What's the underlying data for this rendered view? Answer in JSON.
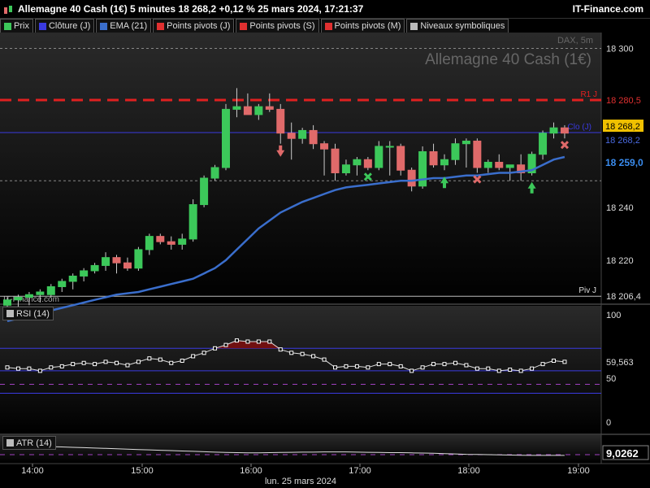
{
  "header": {
    "title": "Allemagne 40 Cash (1€) 5 minutes 18 268,2 +0,12 % 25 mars 2024, 17:21:37",
    "brand": "IT-Finance.com"
  },
  "legend": [
    {
      "label": "Prix",
      "color": "#3cc85a"
    },
    {
      "label": "Clôture (J)",
      "color": "#3a3ae0"
    },
    {
      "label": "EMA (21)",
      "color": "#3a6ecc"
    },
    {
      "label": "Points pivots (J)",
      "color": "#e03030"
    },
    {
      "label": "Points pivots (S)",
      "color": "#e03030"
    },
    {
      "label": "Points pivots (M)",
      "color": "#e03030"
    },
    {
      "label": "Niveaux symboliques",
      "color": "#bbbbbb"
    }
  ],
  "watermark": {
    "name": "Allemagne 40 Cash (1€)",
    "sub": "DAX, 5m",
    "credit": "IT-Finance.com"
  },
  "price_axis_labels": [
    {
      "text": "18 300",
      "value": 18300,
      "style": "tick"
    },
    {
      "text": "18 240",
      "value": 18240,
      "style": "tick"
    },
    {
      "text": "18 220",
      "value": 18220,
      "style": "tick"
    },
    {
      "text": "18 280,5",
      "value": 18280.5,
      "style": "r1"
    },
    {
      "text": "18 268,2",
      "value": 18268.2,
      "style": "last"
    },
    {
      "text": "18 268,2",
      "value": 18268.2,
      "style": "close"
    },
    {
      "text": "18 259,0",
      "value": 18259.0,
      "style": "ema"
    },
    {
      "text": "18 206,4",
      "value": 18206.4,
      "style": "piv"
    }
  ],
  "line_labels": {
    "r1": "R1 J",
    "clo": "Clo (J)",
    "piv": "Piv J"
  },
  "levels": {
    "r1": 18280.5,
    "clo": 18268.2,
    "piv": 18206.4,
    "symbolic": [
      18300,
      18250
    ]
  },
  "rsi": {
    "tag": "RSI (14)",
    "axis": [
      "100",
      "50",
      "0"
    ],
    "value_label": "59,563",
    "bands": [
      70,
      30
    ]
  },
  "atr": {
    "tag": "ATR (14)",
    "value_label": "9,0262"
  },
  "time_axis": {
    "labels": [
      "14:00",
      "15:00",
      "16:00",
      "17:00",
      "18:00",
      "19:00"
    ],
    "date": "lun. 25 mars 2024"
  },
  "colors": {
    "up": "#3cc85a",
    "down": "#e06a6a",
    "ema": "#3a6ecc",
    "r1": "#e02020",
    "close_line": "#3a3ae0",
    "rsi_line": "#dddddd"
  },
  "chart_data": {
    "type": "candlestick",
    "interval": "5m",
    "start_time": "13:50",
    "candles": [
      [
        18203,
        18206,
        18201,
        18205
      ],
      [
        18205,
        18207,
        18202,
        18206
      ],
      [
        18206,
        18208,
        18203,
        18207
      ],
      [
        18207,
        18209,
        18204,
        18208
      ],
      [
        18207,
        18211,
        18206,
        18210
      ],
      [
        18210,
        18213,
        18208,
        18212
      ],
      [
        18212,
        18215,
        18209,
        18214
      ],
      [
        18214,
        18217,
        18212,
        18216
      ],
      [
        18216,
        18219,
        18215,
        18218
      ],
      [
        18218,
        18223,
        18216,
        18221
      ],
      [
        18221,
        18222,
        18215,
        18219
      ],
      [
        18219,
        18221,
        18216,
        18217
      ],
      [
        18217,
        18225,
        18216,
        18224
      ],
      [
        18224,
        18230,
        18222,
        18229
      ],
      [
        18229,
        18230,
        18226,
        18227
      ],
      [
        18227,
        18229,
        18224,
        18226
      ],
      [
        18226,
        18230,
        18224,
        18228
      ],
      [
        18228,
        18243,
        18227,
        18241
      ],
      [
        18241,
        18252,
        18240,
        18251
      ],
      [
        18251,
        18256,
        18250,
        18255
      ],
      [
        18255,
        18279,
        18254,
        18277
      ],
      [
        18277,
        18285,
        18274,
        18278
      ],
      [
        18278,
        18283,
        18275,
        18275
      ],
      [
        18275,
        18279,
        18273,
        18278
      ],
      [
        18278,
        18283,
        18276,
        18277
      ],
      [
        18277,
        18279,
        18264,
        18268
      ],
      [
        18268,
        18272,
        18258,
        18266
      ],
      [
        18266,
        18270,
        18264,
        18269
      ],
      [
        18269,
        18271,
        18262,
        18264
      ],
      [
        18264,
        18265,
        18252,
        18262
      ],
      [
        18262,
        18264,
        18250,
        18253
      ],
      [
        18253,
        18258,
        18252,
        18256
      ],
      [
        18256,
        18259,
        18252,
        18258
      ],
      [
        18258,
        18259,
        18254,
        18255
      ],
      [
        18255,
        18265,
        18254,
        18263
      ],
      [
        18263,
        18265,
        18252,
        18263
      ],
      [
        18263,
        18264,
        18252,
        18254
      ],
      [
        18254,
        18255,
        18246,
        18248
      ],
      [
        18248,
        18263,
        18247,
        18261
      ],
      [
        18261,
        18264,
        18255,
        18256
      ],
      [
        18256,
        18260,
        18254,
        18258
      ],
      [
        18258,
        18266,
        18256,
        18264
      ],
      [
        18264,
        18266,
        18255,
        18265
      ],
      [
        18265,
        18266,
        18253,
        18255
      ],
      [
        18255,
        18258,
        18253,
        18257
      ],
      [
        18257,
        18260,
        18254,
        18255
      ],
      [
        18255,
        18256,
        18250,
        18256
      ],
      [
        18256,
        18260,
        18250,
        18253
      ],
      [
        18253,
        18261,
        18252,
        18260
      ],
      [
        18260,
        18269,
        18258,
        18268
      ],
      [
        18268,
        18272,
        18266,
        18270
      ],
      [
        18270,
        18271,
        18266,
        18268
      ]
    ],
    "ema21": [
      18197,
      18198,
      18199,
      18200,
      18201,
      18202,
      18203,
      18204,
      18205,
      18206,
      18207,
      18207.5,
      18208,
      18209,
      18210,
      18211,
      18212,
      18213,
      18215,
      18217,
      18220,
      18224,
      18228,
      18232,
      18235,
      18238,
      18240,
      18242,
      18243.5,
      18245,
      18246.5,
      18247.5,
      18248,
      18248.5,
      18249,
      18249.5,
      18250,
      18250,
      18250.5,
      18251,
      18251,
      18251.5,
      18252,
      18252,
      18252.5,
      18253,
      18253,
      18253.5,
      18254,
      18256,
      18258,
      18259
    ],
    "rsi14": [
      53,
      52,
      52,
      50,
      53,
      54,
      56,
      57,
      56,
      58,
      57,
      55,
      58,
      61,
      60,
      57,
      59,
      63,
      66,
      70,
      73,
      77,
      76,
      76,
      76,
      69,
      66,
      65,
      63,
      60,
      53,
      54,
      54,
      53,
      56,
      56,
      54,
      50,
      53,
      56,
      56,
      57,
      55,
      52,
      52,
      50,
      51,
      50,
      52,
      56,
      59,
      58
    ],
    "atr14_display_range": [
      5,
      20
    ],
    "atr14": [
      14,
      14,
      14.2,
      14,
      13.8,
      13.6,
      13.4,
      13.2,
      13,
      12.8,
      12.6,
      12.4,
      12.2,
      12,
      11.8,
      11.6,
      11.4,
      11.2,
      11,
      10.8,
      10.6,
      10.5,
      10.4,
      10.4,
      10.5,
      10.6,
      10.7,
      10.8,
      10.8,
      10.9,
      10.9,
      10.9,
      10.8,
      10.7,
      10.6,
      10.5,
      10.5,
      10.4,
      10.3,
      10.2,
      10,
      9.8,
      9.6,
      9.5,
      9.4,
      9.3,
      9.2,
      9.1,
      9.0,
      9.0,
      9.0,
      9.0
    ],
    "markers": [
      {
        "type": "arrow-down",
        "index": 25,
        "color": "#e06a6a"
      },
      {
        "type": "cross",
        "index": 33,
        "color": "#3cc85a"
      },
      {
        "type": "arrow-up",
        "index": 40,
        "color": "#3cc85a"
      },
      {
        "type": "cross",
        "index": 43,
        "color": "#e06a6a"
      },
      {
        "type": "arrow-up",
        "index": 48,
        "color": "#3cc85a"
      },
      {
        "type": "cross",
        "index": 51,
        "color": "#e06a6a"
      }
    ]
  }
}
